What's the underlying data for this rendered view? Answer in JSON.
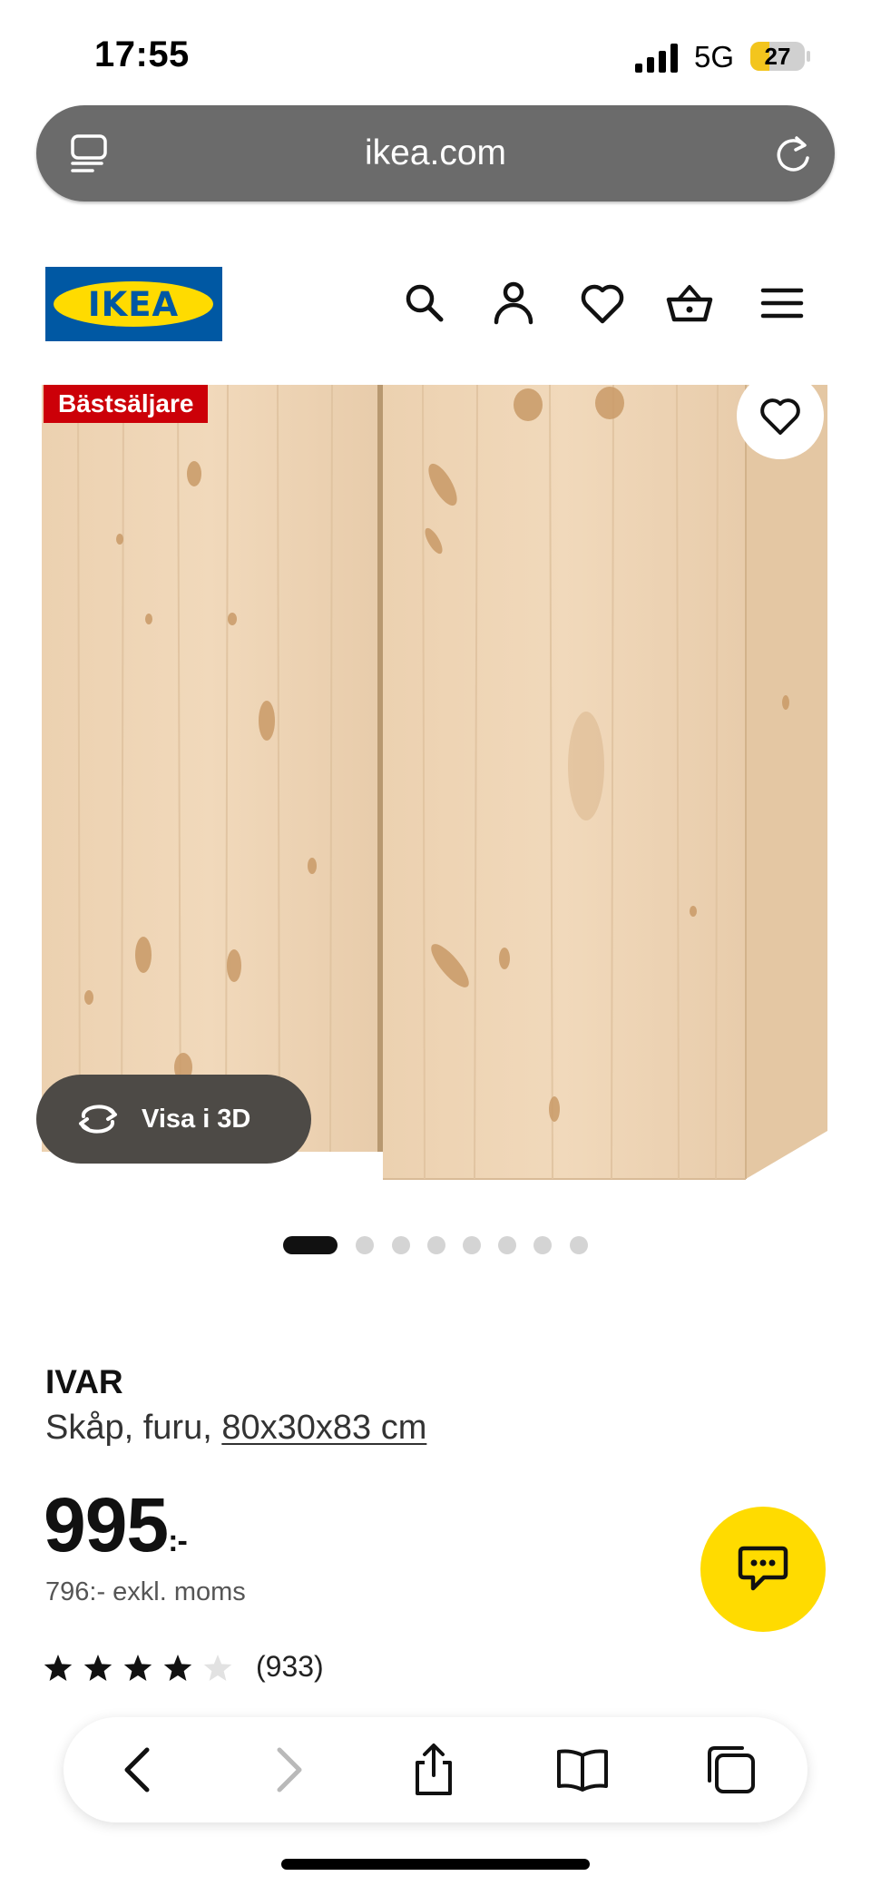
{
  "status_bar": {
    "time": "17:55",
    "network": "5G",
    "battery": "27"
  },
  "browser": {
    "url": "ikea.com"
  },
  "brand": {
    "logo_text": "IKEA",
    "blue": "#0058a3",
    "yellow": "#ffdb00"
  },
  "header": {
    "icons": [
      "search-icon",
      "account-icon",
      "heart-icon",
      "cart-icon",
      "menu-icon"
    ]
  },
  "product": {
    "badge": "Bästsäljare",
    "view_3d_label": "Visa i 3D",
    "image_count": 8,
    "active_image": 1,
    "name": "IVAR",
    "description": "Skåp, furu,",
    "size": "80x30x83 cm",
    "price": "995",
    "price_suffix": ":-",
    "price_ex_vat": "796:- exkl. moms",
    "rating": 4,
    "rating_max": 5,
    "reviews": "(933)"
  },
  "toolbar": {
    "icons": [
      "back-icon",
      "forward-icon",
      "share-icon",
      "bookmarks-icon",
      "tabs-icon"
    ]
  }
}
